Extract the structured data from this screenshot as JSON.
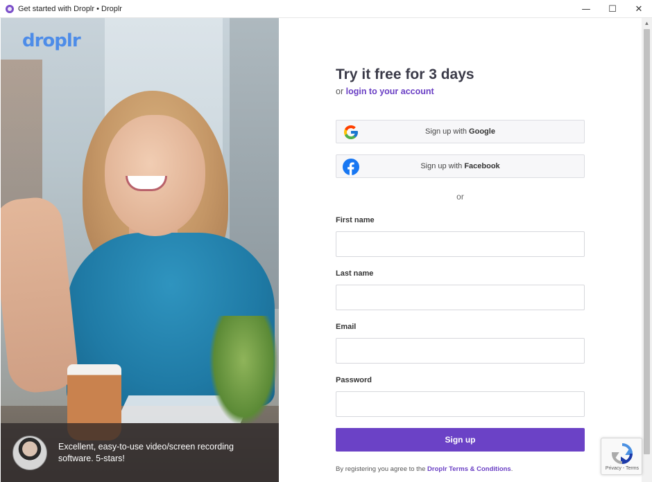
{
  "window": {
    "title": "Get started with Droplr • Droplr",
    "minimize_glyph": "—",
    "maximize_glyph": "☐",
    "close_glyph": "✕"
  },
  "hero": {
    "logo_text": "droplr",
    "testimonial": "Excellent, easy-to-use video/screen recording software. 5-stars!"
  },
  "form": {
    "heading": "Try it free for 3 days",
    "sub_prefix": "or",
    "login_link": "login to your account",
    "google_prefix": "Sign up with",
    "google_brand": "Google",
    "facebook_prefix": "Sign up with",
    "facebook_brand": "Facebook",
    "or_divider": "or",
    "first_name_label": "First name",
    "first_name_value": "",
    "last_name_label": "Last name",
    "last_name_value": "",
    "email_label": "Email",
    "email_value": "",
    "password_label": "Password",
    "password_value": "",
    "signup_button": "Sign up",
    "terms_prefix": "By registering you agree to the",
    "terms_link": "Droplr Terms & Conditions",
    "terms_suffix": "."
  },
  "recaptcha": {
    "privacy": "Privacy",
    "separator": "-",
    "terms": "Terms"
  },
  "colors": {
    "accent": "#6b42c6",
    "logo": "#4d8ce8",
    "facebook": "#1877f2"
  },
  "icons": [
    "app-icon",
    "google-icon",
    "facebook-icon",
    "recaptcha-icon",
    "scroll-up-arrow-icon"
  ]
}
